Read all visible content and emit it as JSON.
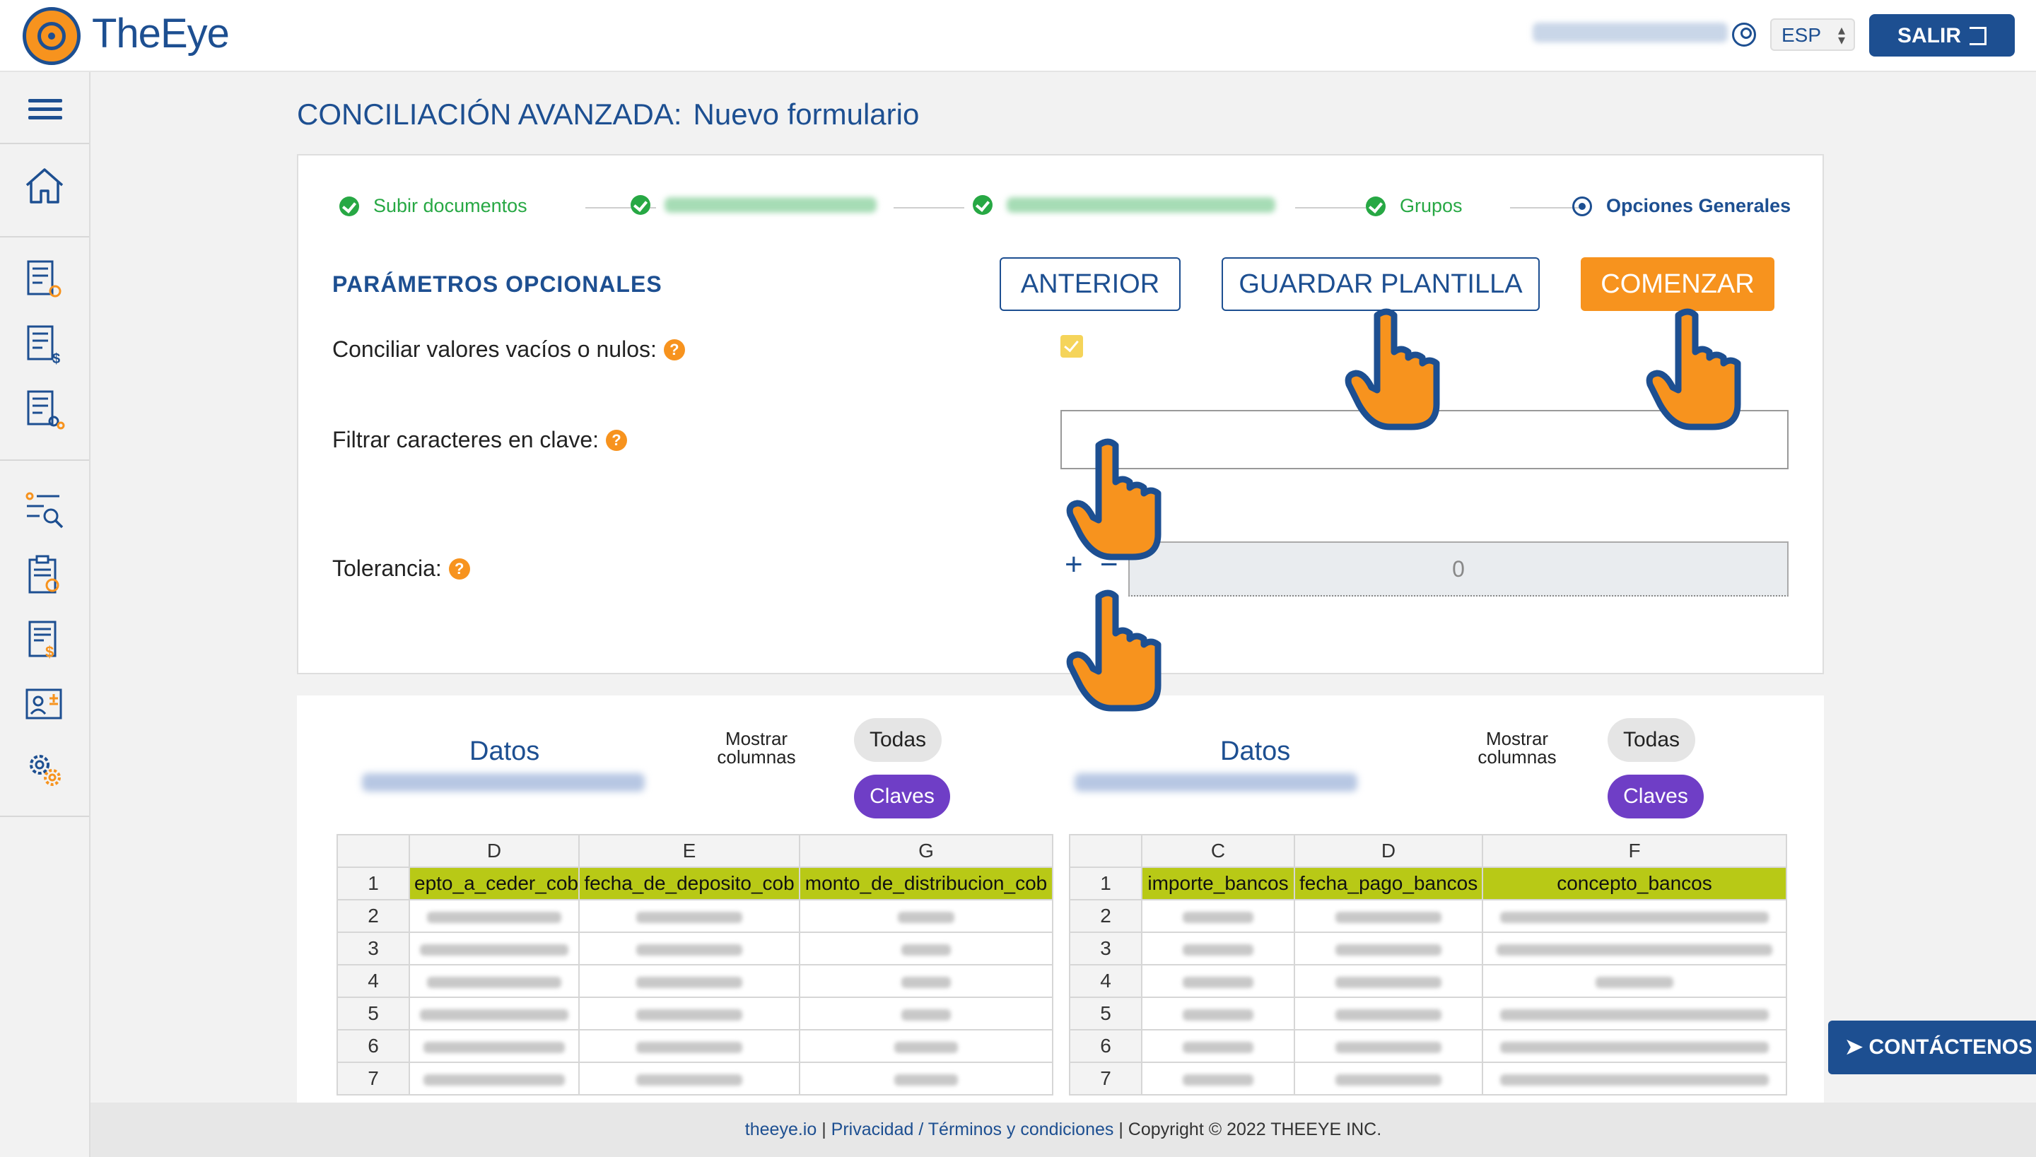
{
  "app": {
    "name": "TheEye",
    "language": "ESP",
    "logout_label": "SALIR",
    "brand_color": "#1d4f91",
    "accent_color": "#f7931e"
  },
  "page": {
    "title": "CONCILIACIÓN AVANZADA:",
    "subtitle": "Nuevo formulario"
  },
  "steps": {
    "step1": "Subir documentos",
    "step4": "Grupos",
    "step5": "Opciones Generales"
  },
  "params": {
    "section_title": "PARÁMETROS OPCIONALES",
    "btn_previous": "ANTERIOR",
    "btn_save_template": "GUARDAR PLANTILLA",
    "btn_start": "COMENZAR",
    "empty_values_label": "Conciliar valores vacíos o nulos:",
    "filter_chars_label": "Filtrar caracteres en clave:",
    "tolerance_label": "Tolerancia:",
    "tolerance_value": "0",
    "plus_minus": "+ −",
    "help_glyph": "?"
  },
  "data_left": {
    "title": "Datos",
    "show_columns": "Mostrar columnas",
    "btn_all": "Todas",
    "btn_keys": "Claves",
    "col_letters": [
      "D",
      "E",
      "G"
    ],
    "headers": [
      "epto_a_ceder_cob",
      "fecha_de_deposito_cob",
      "monto_de_distribucion_cob"
    ],
    "row_numbers": [
      "1",
      "2",
      "3",
      "4",
      "5",
      "6",
      "7"
    ]
  },
  "data_right": {
    "title": "Datos",
    "show_columns": "Mostrar columnas",
    "btn_all": "Todas",
    "btn_keys": "Claves",
    "col_letters": [
      "C",
      "D",
      "F"
    ],
    "headers": [
      "importe_bancos",
      "fecha_pago_bancos",
      "concepto_bancos"
    ],
    "row_numbers": [
      "1",
      "2",
      "3",
      "4",
      "5",
      "6",
      "7"
    ]
  },
  "contact_label": "CONTÁCTENOS",
  "footer": {
    "site": "theeye.io",
    "sep1": " | ",
    "privacy": "Privacidad",
    "slash": " / ",
    "terms": "Términos y condiciones",
    "copyright": " | Copyright © 2022 THEEYE INC."
  }
}
